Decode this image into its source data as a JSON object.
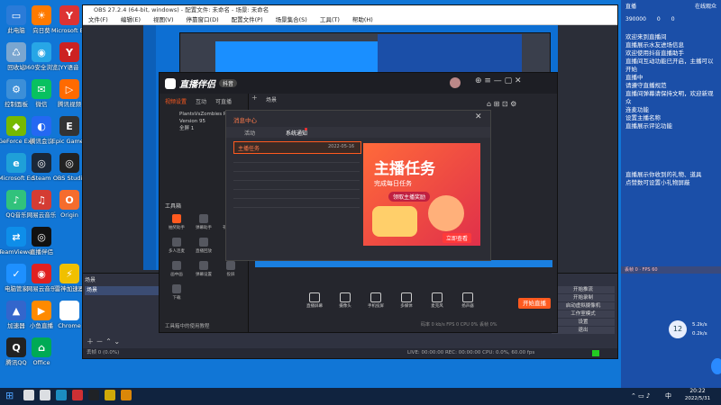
{
  "desktop_icons": [
    {
      "label": "此电脑",
      "color": "#2a7bd8",
      "glyph": "▭"
    },
    {
      "label": "回收站",
      "color": "#7aa6d0",
      "glyph": "♺"
    },
    {
      "label": "控制面板",
      "color": "#3c8fd8",
      "glyph": "⚙"
    },
    {
      "label": "GeForce Experience",
      "color": "#76b900",
      "glyph": "◆"
    },
    {
      "label": "Microsoft Edge",
      "color": "#1fa0d8",
      "glyph": "e"
    },
    {
      "label": "QQ音乐",
      "color": "#31c27c",
      "glyph": "♪"
    },
    {
      "label": "TeamViewer",
      "color": "#0e8ee9",
      "glyph": "⇄"
    },
    {
      "label": "电脑管家",
      "color": "#1e90ff",
      "glyph": "✓"
    },
    {
      "label": "加速器",
      "color": "#3366cc",
      "glyph": "▲"
    },
    {
      "label": "腾讯QQ",
      "color": "#222",
      "glyph": "Q"
    }
  ],
  "desktop_icons_col2": [
    {
      "label": "向日葵",
      "color": "#ff7a00",
      "glyph": "☀"
    },
    {
      "label": "360安全浏览器",
      "color": "#27a6e6",
      "glyph": "◉"
    },
    {
      "label": "微信",
      "color": "#08c160",
      "glyph": "✉"
    },
    {
      "label": "腾讯会议",
      "color": "#2468f2",
      "glyph": "◐"
    },
    {
      "label": "Steam",
      "color": "#1b2838",
      "glyph": "◎"
    },
    {
      "label": "网易云音乐",
      "color": "#d43c33",
      "glyph": "♫"
    },
    {
      "label": "直播伴侣",
      "color": "#111",
      "glyph": "◎"
    },
    {
      "label": "网易云音乐",
      "color": "#e02020",
      "glyph": "◉"
    },
    {
      "label": "小鱼直播",
      "color": "#ff8a00",
      "glyph": "▶"
    },
    {
      "label": "Office",
      "color": "#0a5",
      "glyph": "⌂"
    }
  ],
  "desktop_icons_col3": [
    {
      "label": "Microsoft Edge",
      "color": "#d33",
      "glyph": "Y"
    },
    {
      "label": "YY语音",
      "color": "#c22",
      "glyph": "Y"
    },
    {
      "label": "腾讯视频",
      "color": "#ff6a00",
      "glyph": "▷"
    },
    {
      "label": "Epic Games",
      "color": "#333",
      "glyph": "E"
    },
    {
      "label": "OBS Studio",
      "color": "#222",
      "glyph": "◎"
    },
    {
      "label": "Origin",
      "color": "#f56c2d",
      "glyph": "O"
    },
    {
      "label": "",
      "color": "transparent",
      "glyph": ""
    },
    {
      "label": "雷神加速器",
      "color": "#f0c000",
      "glyph": "⚡"
    },
    {
      "label": "Chrome",
      "color": "#fff",
      "glyph": "△"
    }
  ],
  "obs": {
    "title": "OBS 27.2.4 (64-bit, windows) - 配置文件: 未命名 - 场景: 未命名",
    "menu": [
      "文件(F)",
      "编辑(E)",
      "视图(V)",
      "停靠窗口(D)",
      "配置文件(P)",
      "场景集合(S)",
      "工具(T)",
      "帮助(H)"
    ],
    "sources_label": "来源",
    "scenes_label": "场景",
    "scene_item": "场景",
    "mixer_label": "混音器",
    "controls": [
      "开始推流",
      "开始录制",
      "启动虚拟摄像机",
      "工作室模式",
      "设置",
      "退出"
    ],
    "status": "LIVE: 00:00:00   REC: 00:00:00   CPU: 0.0%, 60.00 fps",
    "dropped": "丢帧 0 (0.0%)"
  },
  "app": {
    "logo": "直播伴侣",
    "badge": "抖音",
    "tabs": [
      "视频设置",
      "互动",
      "可直播"
    ],
    "plus": "+",
    "scene_tab": "场景",
    "sources": [
      "PlantsVsZombies Plus",
      "Version 95",
      "全屏 1"
    ],
    "tools_title": "工具箱",
    "tools": [
      "抽奖助手",
      "弹幕助手",
      "礼物合集",
      "多人连麦",
      "直播回放",
      "贴纸",
      "画中画",
      "弹幕设置",
      "投屏",
      "下载"
    ],
    "bottom_tabs": [
      "直播屏幕",
      "摄像头",
      "手机投屏",
      "多媒体",
      "麦克风",
      "扬声器"
    ],
    "start_btn": "开始直播",
    "status_bar": "码率 0 kb/s   FPS 0   CPU 0%   丢帧 0%",
    "notice": "工具箱中的使用教程",
    "viewer_avatar": "主播"
  },
  "message": {
    "title": "消息中心",
    "tabs": [
      "活动",
      "系统通知"
    ],
    "item_title": "主播任务",
    "item_date": "2022-05-16",
    "banner_big": "主播任务",
    "banner_sub": "完成每日任务",
    "banner_pill": "领取主播奖励",
    "banner_btn": "立即查看"
  },
  "right_panel": {
    "header": [
      "直播",
      "在线观众"
    ],
    "counts": [
      "390000",
      "0",
      "0"
    ],
    "lines": [
      "欢迎来到直播间",
      "直播展示水友进场信息",
      "欢迎使用抖音直播助手",
      "直播间互动功能已开启，主播可以开始",
      "直播中",
      "请遵守直播规范",
      "直播间弹幕请保持文明，欢迎新观众",
      "连麦功能",
      "设置主播名称",
      "直播展示评论功能"
    ],
    "lines2": [
      "直播展示你收到的礼物、道具",
      "点赞数可设置小礼物屏蔽"
    ],
    "speed_up": "5.2k/s",
    "speed_down": "0.2k/s",
    "circle": "12"
  },
  "taskbar": {
    "time": "20:22",
    "date": "2022/5/31",
    "lang": "中",
    "apps": [
      "搜索",
      "任务视图",
      "Edge",
      "直播伴侣",
      "OBS",
      "资源管理器",
      "抖音直播伴侣"
    ]
  },
  "colors": {
    "desktop": "#1176d6",
    "accent": "#ff5a1f",
    "app_bg": "#25262d",
    "panel": "#1b4fa8"
  }
}
